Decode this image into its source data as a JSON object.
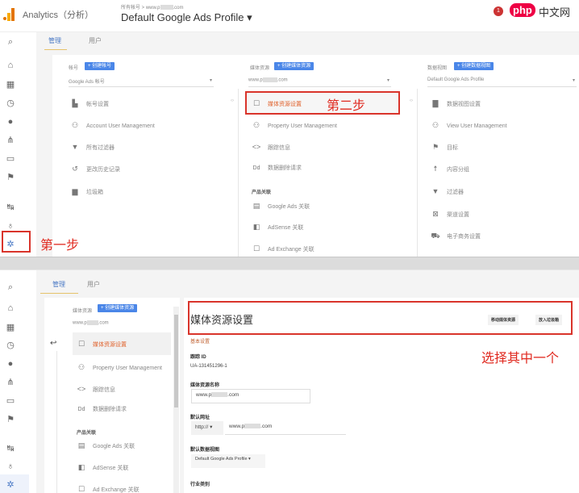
{
  "header": {
    "app_name": "Analytics（分析）",
    "breadcrumb": "所有帐号 > www.p",
    "breadcrumb_suffix": ".com",
    "title": "Default Google Ads Profile",
    "notification_count": "1",
    "watermark": "php中文网"
  },
  "tabs": [
    "管理",
    "用户"
  ],
  "columns": [
    {
      "label": "帐号",
      "create_button": "+ 创建帐号",
      "selector": "Google Ads 帐号",
      "items": [
        {
          "icon": "building-icon",
          "label": "帐号设置"
        },
        {
          "icon": "people-icon",
          "label": "Account User Management"
        },
        {
          "icon": "filter-icon",
          "label": "所有过滤器"
        },
        {
          "icon": "history-icon",
          "label": "更改历史记录"
        },
        {
          "icon": "trash-icon",
          "label": "垃圾箱"
        }
      ]
    },
    {
      "label": "媒体资源",
      "create_button": "+ 创建媒体资源",
      "selector": "www.p",
      "selector_suffix": ".com",
      "items": [
        {
          "icon": "square-icon",
          "label": "媒体资源设置"
        },
        {
          "icon": "people-icon",
          "label": "Property User Management"
        },
        {
          "icon": "code-icon",
          "label": "跟踪信息"
        },
        {
          "icon": "dd-icon",
          "label": "数据删除请求"
        }
      ],
      "section": "产品关联",
      "links": [
        {
          "icon": "ads-icon",
          "label": "Google Ads 关联"
        },
        {
          "icon": "adsense-icon",
          "label": "AdSense 关联"
        },
        {
          "icon": "adexchange-icon",
          "label": "Ad Exchange 关联"
        }
      ]
    },
    {
      "label": "数据视图",
      "create_button": "+ 创建数据视图",
      "selector": "Default Google Ads Profile",
      "items": [
        {
          "icon": "doc-icon",
          "label": "数据视图设置"
        },
        {
          "icon": "people-icon",
          "label": "View User Management"
        },
        {
          "icon": "flag-icon",
          "label": "目标"
        },
        {
          "icon": "person-icon",
          "label": "内容分组"
        },
        {
          "icon": "filter-icon",
          "label": "过滤器"
        },
        {
          "icon": "channel-icon",
          "label": "渠道设置"
        },
        {
          "icon": "cart-icon",
          "label": "电子商务设置"
        }
      ]
    }
  ],
  "annotations": {
    "step1": "第一步",
    "step2": "第二步",
    "choose": "选择其中一个"
  },
  "detail": {
    "title": "媒体资源设置",
    "buttons": [
      "移动媒体资源",
      "放入垃圾箱"
    ],
    "section": "基本设置",
    "tracking_id_label": "跟踪 ID",
    "tracking_id": "UA-131451296-1",
    "name_label": "媒体资源名称",
    "name_value": "www.p",
    "name_suffix": ".com",
    "url_label": "默认网址",
    "protocol": "http://",
    "url_value": "www.p",
    "url_suffix": ".com",
    "view_label": "默认数据视图",
    "view_value": "Default Google Ads Profile",
    "industry_label": "行业类别"
  },
  "colors": {
    "accent": "#4a86e8",
    "annotation": "#e0291f"
  }
}
